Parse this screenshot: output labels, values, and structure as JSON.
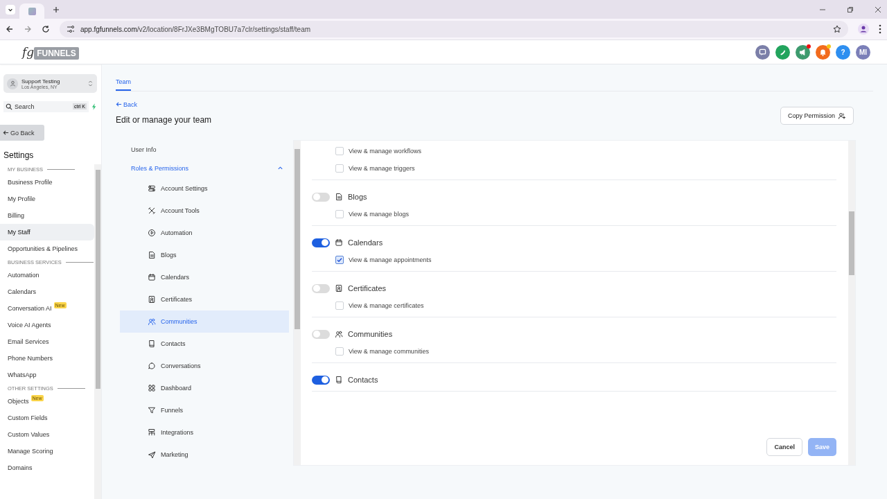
{
  "browser": {
    "url_host": "app.fgfunnels.com",
    "url_path": "/v2/location/8FrJXe3BMgTOBU7a7clr/settings/staff/team"
  },
  "logo": {
    "prefix": "fg",
    "name": "FUNNELS"
  },
  "header_icons": [
    {
      "kind": "chat",
      "badge": false
    },
    {
      "kind": "phone",
      "badge": false
    },
    {
      "kind": "megaphone",
      "badge": true
    },
    {
      "kind": "bell",
      "badge": true
    },
    {
      "kind": "help",
      "label": "?",
      "badge": false
    },
    {
      "kind": "avatar",
      "label": "MI",
      "badge": false
    }
  ],
  "account": {
    "name": "Support Testing",
    "location": "Los Angeles, NY"
  },
  "search": {
    "placeholder": "Search",
    "shortcut": "ctrl K"
  },
  "go_back": "Go Back",
  "sidebar_title": "Settings",
  "sidebar": [
    {
      "kind": "heading",
      "label": "MY BUSINESS"
    },
    {
      "kind": "item",
      "label": "Business Profile",
      "selected": false
    },
    {
      "kind": "item",
      "label": "My Profile",
      "selected": false
    },
    {
      "kind": "item",
      "label": "Billing",
      "selected": false
    },
    {
      "kind": "item",
      "label": "My Staff",
      "selected": true
    },
    {
      "kind": "item",
      "label": "Opportunities & Pipelines",
      "selected": false
    },
    {
      "kind": "heading",
      "label": "BUSINESS SERVICES"
    },
    {
      "kind": "item",
      "label": "Automation",
      "selected": false
    },
    {
      "kind": "item",
      "label": "Calendars",
      "selected": false
    },
    {
      "kind": "item",
      "label": "Conversation AI",
      "selected": false,
      "badge": "New"
    },
    {
      "kind": "item",
      "label": "Voice AI Agents",
      "selected": false
    },
    {
      "kind": "item",
      "label": "Email Services",
      "selected": false
    },
    {
      "kind": "item",
      "label": "Phone Numbers",
      "selected": false
    },
    {
      "kind": "item",
      "label": "WhatsApp",
      "selected": false
    },
    {
      "kind": "heading",
      "label": "OTHER SETTINGS"
    },
    {
      "kind": "item",
      "label": "Objects",
      "selected": false,
      "badge": "New"
    },
    {
      "kind": "item",
      "label": "Custom Fields",
      "selected": false
    },
    {
      "kind": "item",
      "label": "Custom Values",
      "selected": false
    },
    {
      "kind": "item",
      "label": "Manage Scoring",
      "selected": false
    },
    {
      "kind": "item",
      "label": "Domains",
      "selected": false
    }
  ],
  "tabs": [
    {
      "label": "Team",
      "selected": true
    }
  ],
  "back": "Back",
  "title": "Edit or manage your team",
  "copy_permission": "Copy Permission",
  "subnav": [
    {
      "label": "User Info",
      "selected": false
    },
    {
      "label": "Roles & Permissions",
      "selected": false,
      "expanded": true,
      "children": [
        {
          "label": "Account Settings",
          "selected": false
        },
        {
          "label": "Account Tools",
          "selected": false
        },
        {
          "label": "Automation",
          "selected": false
        },
        {
          "label": "Blogs",
          "selected": false
        },
        {
          "label": "Calendars",
          "selected": false
        },
        {
          "label": "Certificates",
          "selected": false
        },
        {
          "label": "Communities",
          "selected": true
        },
        {
          "label": "Contacts",
          "selected": false
        },
        {
          "label": "Conversations",
          "selected": false
        },
        {
          "label": "Dashboard",
          "selected": false
        },
        {
          "label": "Funnels",
          "selected": false
        },
        {
          "label": "Integrations",
          "selected": false
        },
        {
          "label": "Marketing",
          "selected": false
        }
      ]
    }
  ],
  "permission_sections": [
    {
      "permissions": [
        {
          "label": "View & manage workflows",
          "checked": false
        },
        {
          "label": "View & manage triggers",
          "checked": false
        }
      ]
    },
    {
      "title": "Blogs",
      "on": false,
      "permissions": [
        {
          "label": "View & manage blogs",
          "checked": false
        }
      ]
    },
    {
      "title": "Calendars",
      "on": true,
      "permissions": [
        {
          "label": "View & manage appointments",
          "checked": true
        }
      ]
    },
    {
      "title": "Certificates",
      "on": false,
      "permissions": [
        {
          "label": "View & manage certificates",
          "checked": false
        }
      ]
    },
    {
      "title": "Communities",
      "on": false,
      "permissions": [
        {
          "label": "View & manage communities",
          "checked": false
        }
      ]
    },
    {
      "title": "Contacts",
      "on": true
    }
  ],
  "footer": {
    "cancel": "Cancel",
    "save": "Save",
    "save_disabled": true
  }
}
